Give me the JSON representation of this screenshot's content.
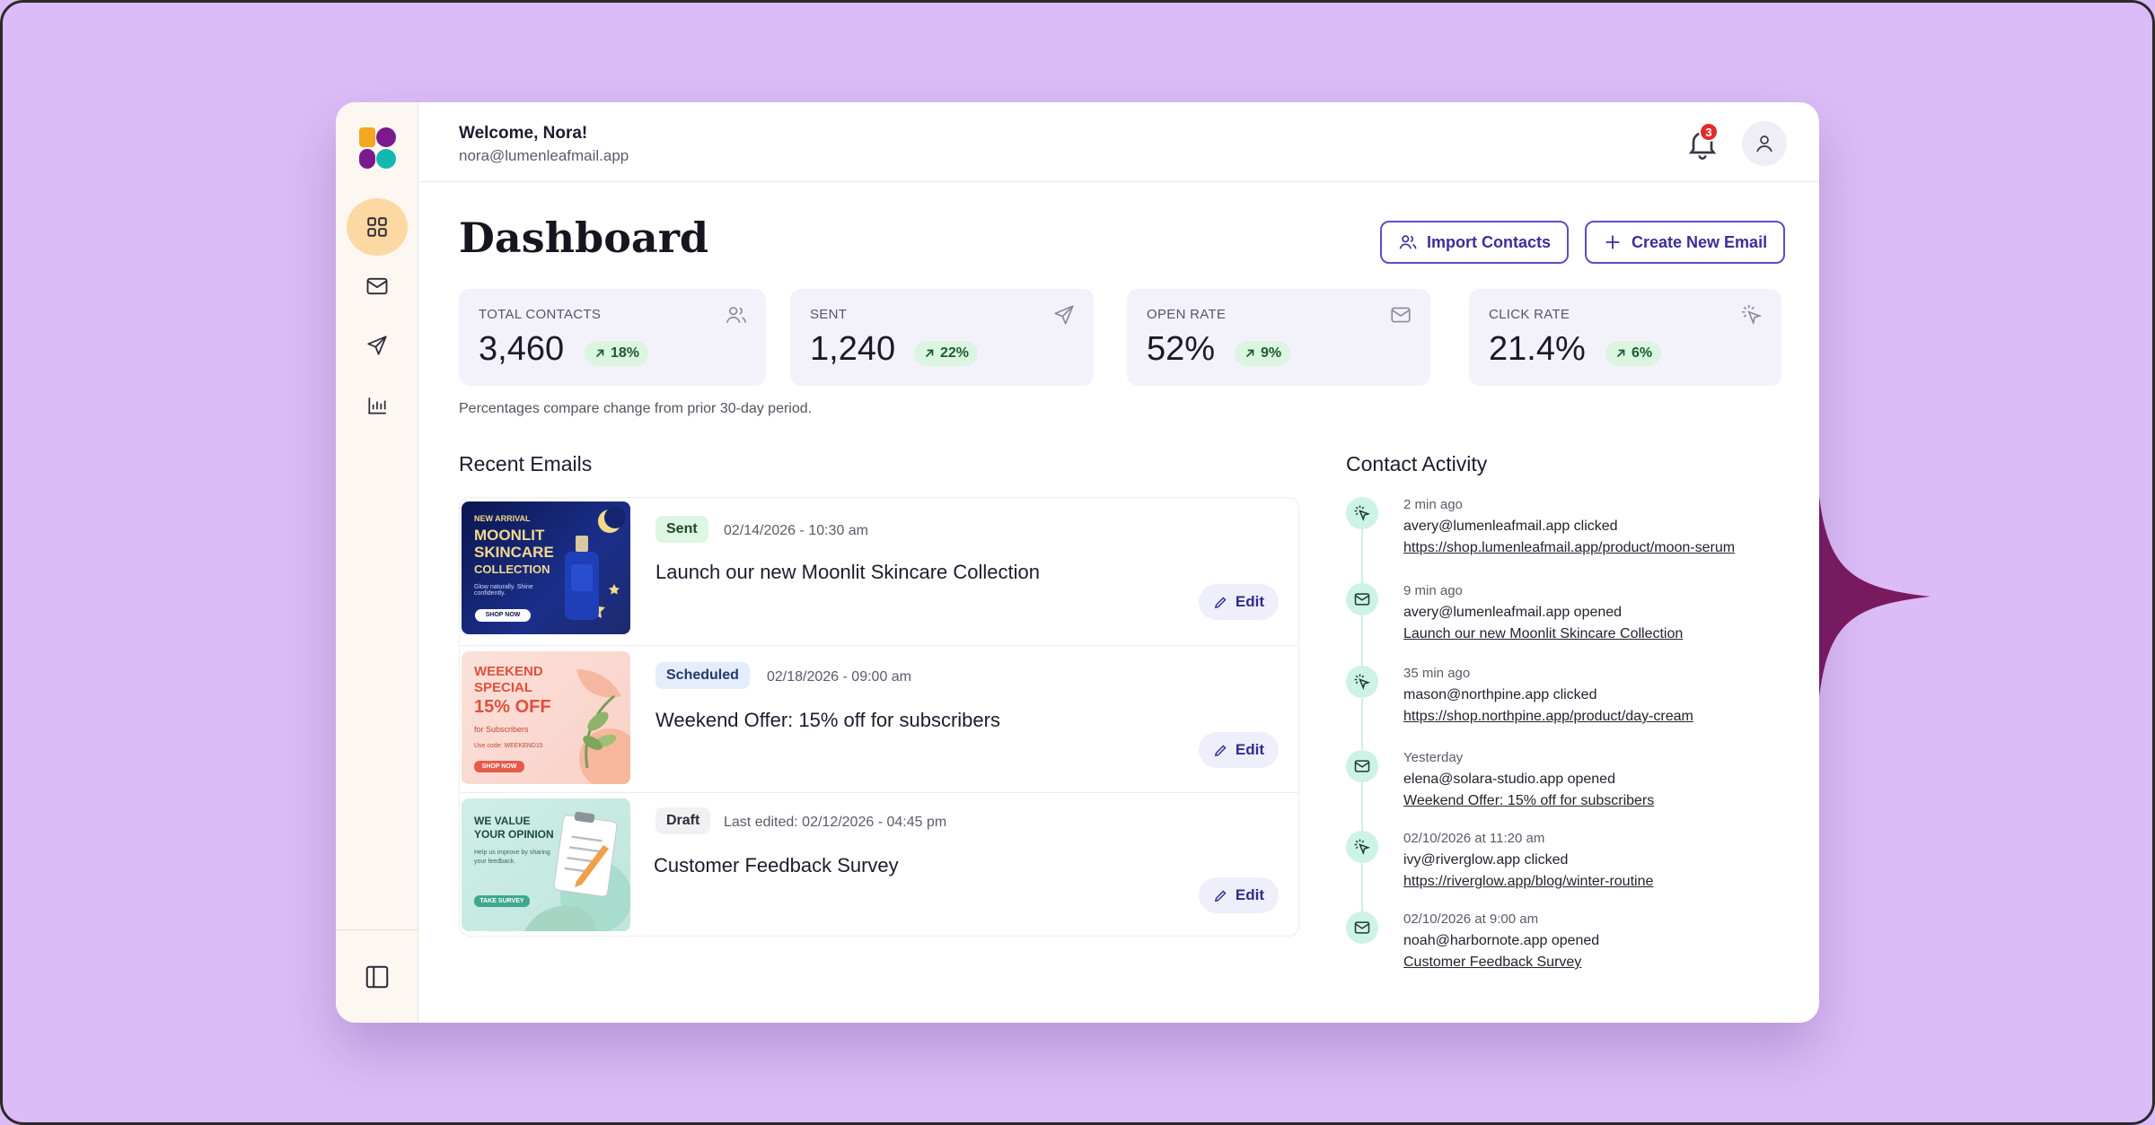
{
  "user": {
    "welcome": "Welcome, Nora!",
    "email": "nora@lumenleafmail.app"
  },
  "notifications": {
    "count": "3"
  },
  "sidebar": {
    "items": [
      {
        "icon": "grid-icon",
        "active": true
      },
      {
        "icon": "mail-icon"
      },
      {
        "icon": "send-icon"
      },
      {
        "icon": "bar-chart-icon"
      }
    ],
    "bottom_icon": "sidebar-toggle-icon"
  },
  "page": {
    "title": "Dashboard"
  },
  "actions": {
    "import_label": "Import Contacts",
    "create_label": "Create New Email"
  },
  "stats": [
    {
      "label": "TOTAL CONTACTS",
      "value": "3,460",
      "trend": "18%",
      "icon": "users-icon"
    },
    {
      "label": "SENT",
      "value": "1,240",
      "trend": "22%",
      "icon": "send-icon"
    },
    {
      "label": "OPEN RATE",
      "value": "52%",
      "trend": "9%",
      "icon": "mail-icon"
    },
    {
      "label": "CLICK RATE",
      "value": "21.4%",
      "trend": "6%",
      "icon": "click-icon"
    }
  ],
  "footnote": "Percentages compare change from prior 30-day period.",
  "recent_emails": {
    "title": "Recent Emails",
    "edit_label": "Edit",
    "items": [
      {
        "status": "Sent",
        "date": "02/14/2026 - 10:30 am",
        "subject": "Launch our new Moonlit Skincare Collection",
        "thumb": {
          "eyebrow": "NEW ARRIVAL",
          "line1": "MOONLIT",
          "line2": "SKINCARE",
          "line3": "COLLECTION",
          "sub": "Glow naturally. Shine confidently.",
          "cta": "SHOP NOW"
        }
      },
      {
        "status": "Scheduled",
        "date": "02/18/2026 - 09:00 am",
        "subject": "Weekend Offer: 15% off for subscribers",
        "thumb": {
          "line1": "WEEKEND",
          "line2": "SPECIAL",
          "line3": "15% OFF",
          "sub": "for Subscribers",
          "code": "Use code: WEEKEND15",
          "cta": "SHOP NOW"
        }
      },
      {
        "status": "Draft",
        "date": "Last edited: 02/12/2026 - 04:45 pm",
        "subject": "Customer Feedback Survey",
        "thumb": {
          "line1": "WE VALUE",
          "line2": "YOUR OPINION",
          "sub": "Help us improve by sharing your feedback.",
          "cta": "TAKE SURVEY"
        }
      }
    ]
  },
  "contact_activity": {
    "title": "Contact Activity",
    "items": [
      {
        "type": "click",
        "time": "2 min ago",
        "text": "avery@lumenleafmail.app clicked",
        "link": "https://shop.lumenleafmail.app/product/moon-serum"
      },
      {
        "type": "open",
        "time": "9 min ago",
        "text": "avery@lumenleafmail.app opened",
        "link": "Launch our new Moonlit Skincare Collection"
      },
      {
        "type": "click",
        "time": "35 min ago",
        "text": "mason@northpine.app clicked",
        "link": "https://shop.northpine.app/product/day-cream"
      },
      {
        "type": "open",
        "time": "Yesterday",
        "text": "elena@solara-studio.app opened",
        "link": "Weekend Offer: 15% off for subscribers"
      },
      {
        "type": "click",
        "time": "02/10/2026 at 11:20 am",
        "text": "ivy@riverglow.app clicked",
        "link": "https://riverglow.app/blog/winter-routine"
      },
      {
        "type": "open",
        "time": "02/10/2026 at 9:00 am",
        "text": "noah@harbornote.app opened",
        "link": "Customer Feedback Survey"
      }
    ]
  },
  "colors": {
    "background": "#dcbcf7",
    "accent": "#5b4fc4",
    "sparkle": "#7a1a5e",
    "trend_bg": "#dcf5e1"
  }
}
